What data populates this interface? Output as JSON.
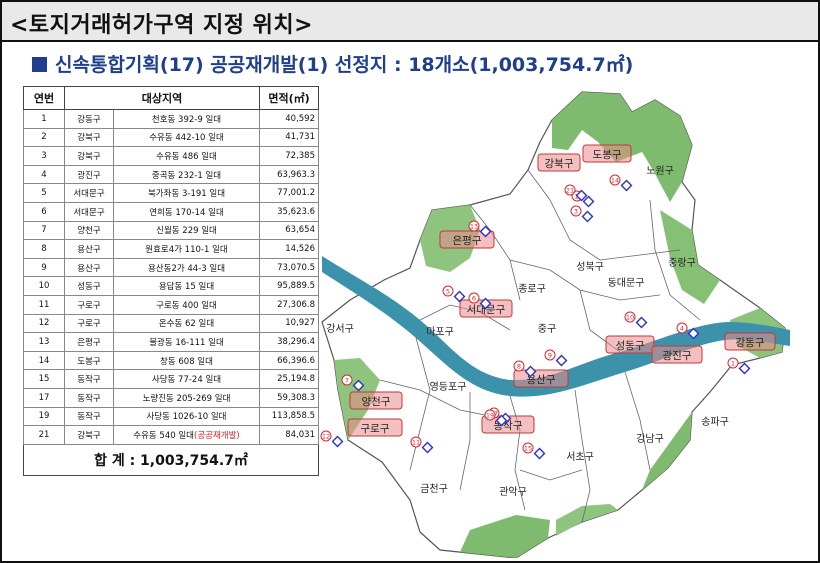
{
  "header": {
    "title": "<토지거래허가구역 지정 위치>"
  },
  "subtitle": {
    "prefix": "신속통합기획(17) 공공재개발(1) 선정지 : ",
    "count": "18개소(1,003,754.7㎡)"
  },
  "table": {
    "headers": [
      "연번",
      "대상지역",
      "면적(㎡)"
    ],
    "rows": [
      {
        "no": "1",
        "gu": "강동구",
        "addr": "천호동 392-9 일대",
        "area": "40,592"
      },
      {
        "no": "2",
        "gu": "강북구",
        "addr": "수유동 442-10 일대",
        "area": "41,731"
      },
      {
        "no": "3",
        "gu": "강북구",
        "addr": "수유동 486 일대",
        "area": "72,385"
      },
      {
        "no": "4",
        "gu": "광진구",
        "addr": "중곡동 232-1 일대",
        "area": "63,963.3"
      },
      {
        "no": "5",
        "gu": "서대문구",
        "addr": "북가좌동 3-191 일대",
        "area": "77,001.2"
      },
      {
        "no": "6",
        "gu": "서대문구",
        "addr": "연희동 170-14 일대",
        "area": "35,623.6"
      },
      {
        "no": "7",
        "gu": "양천구",
        "addr": "신월동 229 일대",
        "area": "63,654"
      },
      {
        "no": "8",
        "gu": "용산구",
        "addr": "원효로4가 110-1 일대",
        "area": "14,526"
      },
      {
        "no": "9",
        "gu": "용산구",
        "addr": "용산동2가 44-3 일대",
        "area": "73,070.5"
      },
      {
        "no": "10",
        "gu": "성동구",
        "addr": "용답동 15 일대",
        "area": "95,889.5"
      },
      {
        "no": "11",
        "gu": "구로구",
        "addr": "구로동 400 일대",
        "area": "27,306.8"
      },
      {
        "no": "12",
        "gu": "구로구",
        "addr": "온수동 62 일대",
        "area": "10,927"
      },
      {
        "no": "13",
        "gu": "은평구",
        "addr": "불광동 16-111 일대",
        "area": "38,296.4"
      },
      {
        "no": "14",
        "gu": "도봉구",
        "addr": "창동 608 일대",
        "area": "66,396.6"
      },
      {
        "no": "15",
        "gu": "동작구",
        "addr": "사당동 77-24 일대",
        "area": "25,194.8"
      },
      {
        "no": "17",
        "gu": "동작구",
        "addr": "노량진동 205-269 일대",
        "area": "59,308.3"
      },
      {
        "no": "19",
        "gu": "동작구",
        "addr": "사당동 1026-10 일대",
        "area": "113,858.5"
      }
    ],
    "last_row": {
      "no": "21",
      "gu": "강북구",
      "addr": "수유동 540 일대",
      "note": "(공공재개발)",
      "area": "84,031"
    },
    "total_label": "합   계 : 1,003,754.7㎡"
  },
  "map": {
    "district_labels": [
      "노원구",
      "중랑구",
      "성북구",
      "동대문구",
      "종로구",
      "중구",
      "마포구",
      "강서구",
      "영등포구",
      "서초구",
      "강남구",
      "송파구",
      "금천구",
      "관악구"
    ],
    "highlighted_labels": [
      "강북구",
      "도봉구",
      "은평구",
      "서대문구",
      "용산구",
      "성동구",
      "광진구",
      "강동구",
      "양천구",
      "구로구",
      "동작구"
    ],
    "site_numbers": [
      "1",
      "2",
      "3",
      "4",
      "5",
      "6",
      "7",
      "8",
      "9",
      "10",
      "11",
      "12",
      "13",
      "14",
      "15",
      "17",
      "19",
      "21"
    ],
    "colors": {
      "green": "#7fbb6e",
      "river": "#3c92aa",
      "site_marker": "#2d33c8",
      "site_number": "#d3292f",
      "highlight_box": "#e98a8a"
    }
  }
}
